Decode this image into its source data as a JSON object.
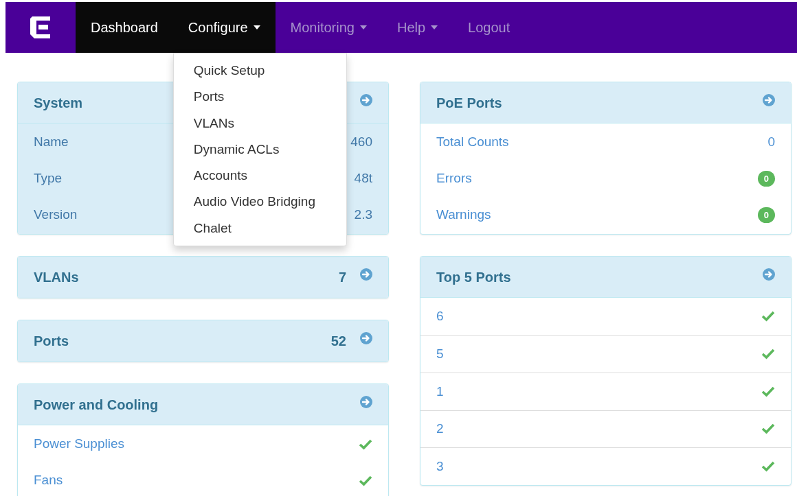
{
  "navbar": {
    "items": [
      {
        "label": "Dashboard",
        "highlighted": true,
        "caret": false,
        "open": false
      },
      {
        "label": "Configure",
        "highlighted": true,
        "caret": true,
        "open": true
      },
      {
        "label": "Monitoring",
        "highlighted": false,
        "caret": true,
        "open": false
      },
      {
        "label": "Help",
        "highlighted": false,
        "caret": true,
        "open": false
      },
      {
        "label": "Logout",
        "highlighted": false,
        "caret": false,
        "open": false
      }
    ]
  },
  "dropdown": {
    "items": [
      "Quick Setup",
      "Ports",
      "VLANs",
      "Dynamic ACLs",
      "Accounts",
      "Audio Video Bridging",
      "Chalet"
    ]
  },
  "columns": [
    {
      "panels": [
        {
          "kind": "info",
          "title": "System",
          "rows": [
            {
              "label": "Name",
              "value": "460"
            },
            {
              "label": "Type",
              "value": "48t"
            },
            {
              "label": "Version",
              "value": "2.3"
            }
          ]
        },
        {
          "kind": "summary",
          "title": "VLANs",
          "count": "7"
        },
        {
          "kind": "summary",
          "title": "Ports",
          "count": "52"
        },
        {
          "kind": "status",
          "title": "Power and Cooling",
          "rows": [
            {
              "label": "Power Supplies",
              "ok": true
            },
            {
              "label": "Fans",
              "ok": true
            }
          ]
        }
      ]
    },
    {
      "panels": [
        {
          "kind": "links",
          "title": "PoE Ports",
          "rows": [
            {
              "label": "Total Counts",
              "value": "0"
            },
            {
              "label": "Errors",
              "badge": "0"
            },
            {
              "label": "Warnings",
              "badge": "0"
            }
          ]
        },
        {
          "kind": "list",
          "title": "Top 5 Ports",
          "rows": [
            {
              "label": "6",
              "ok": true
            },
            {
              "label": "5",
              "ok": true
            },
            {
              "label": "1",
              "ok": true
            },
            {
              "label": "2",
              "ok": true
            },
            {
              "label": "3",
              "ok": true
            }
          ]
        }
      ]
    }
  ]
}
